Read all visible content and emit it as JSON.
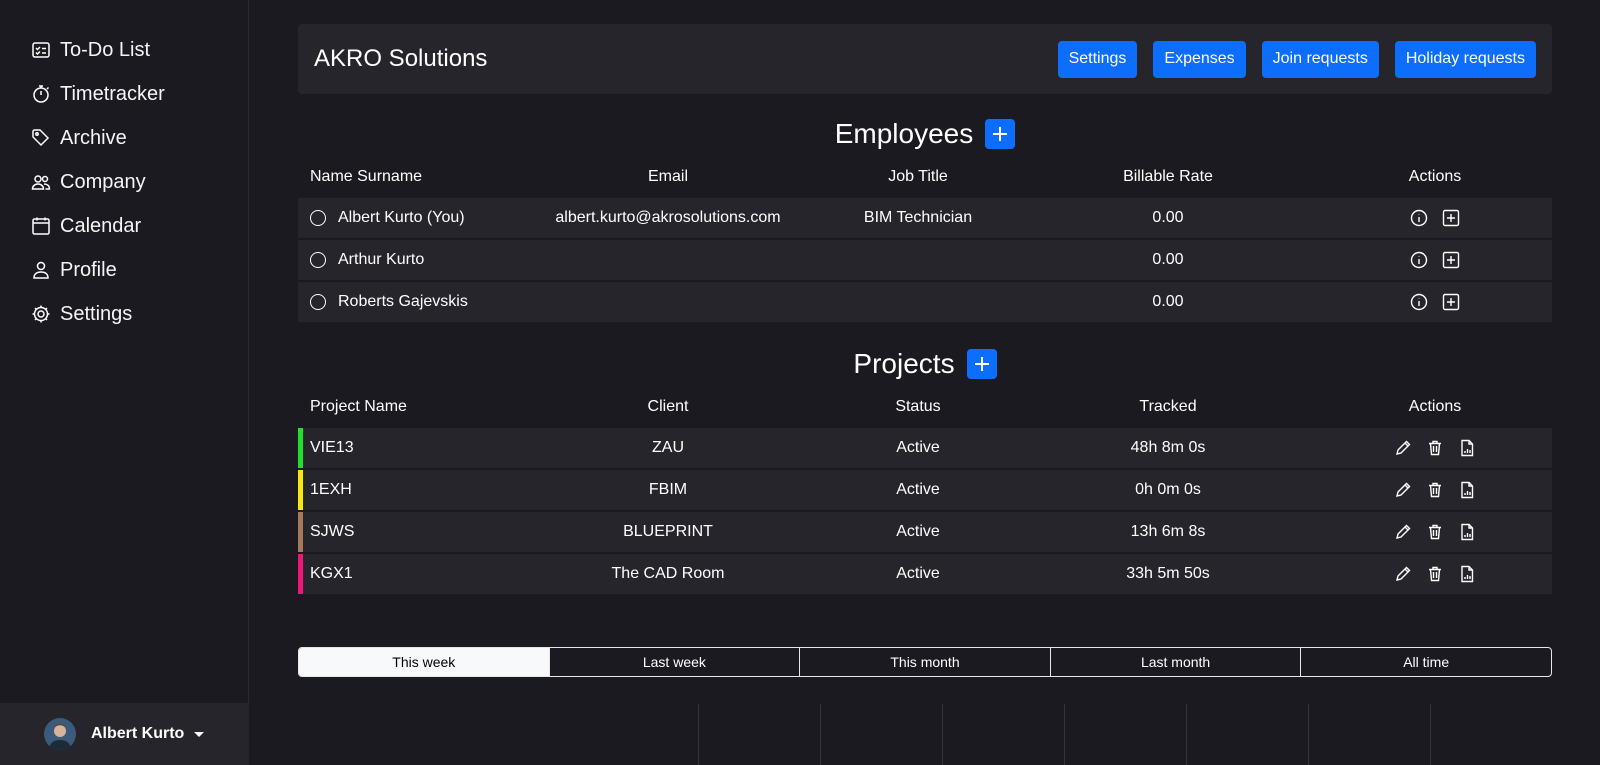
{
  "sidebar": {
    "items": [
      {
        "label": "To-Do List",
        "icon": "list-check-icon"
      },
      {
        "label": "Timetracker",
        "icon": "stopwatch-icon"
      },
      {
        "label": "Archive",
        "icon": "tags-icon"
      },
      {
        "label": "Company",
        "icon": "people-icon"
      },
      {
        "label": "Calendar",
        "icon": "calendar-icon"
      },
      {
        "label": "Profile",
        "icon": "person-icon"
      },
      {
        "label": "Settings",
        "icon": "gear-icon"
      }
    ],
    "user": {
      "name": "Albert Kurto"
    }
  },
  "header": {
    "company": "AKRO Solutions",
    "buttons": {
      "settings": "Settings",
      "expenses": "Expenses",
      "join": "Join requests",
      "holiday": "Holiday requests"
    }
  },
  "employees": {
    "title": "Employees",
    "columns": [
      "Name Surname",
      "Email",
      "Job Title",
      "Billable Rate",
      "Actions"
    ],
    "rows": [
      {
        "name": "Albert Kurto (You)",
        "email": "albert.kurto@akrosolutions.com",
        "job": "BIM Technician",
        "rate": "0.00"
      },
      {
        "name": "Arthur Kurto",
        "email": "",
        "job": "",
        "rate": "0.00"
      },
      {
        "name": "Roberts Gajevskis",
        "email": "",
        "job": "",
        "rate": "0.00"
      }
    ]
  },
  "projects": {
    "title": "Projects",
    "columns": [
      "Project Name",
      "Client",
      "Status",
      "Tracked",
      "Actions"
    ],
    "rows": [
      {
        "name": "VIE13",
        "client": "ZAU",
        "status": "Active",
        "tracked": "48h 8m 0s",
        "color": "#22e02a"
      },
      {
        "name": "1EXH",
        "client": "FBIM",
        "status": "Active",
        "tracked": "0h 0m 0s",
        "color": "#f5e614"
      },
      {
        "name": "SJWS",
        "client": "BLUEPRINT",
        "status": "Active",
        "tracked": "13h 6m 8s",
        "color": "#a47a5a"
      },
      {
        "name": "KGX1",
        "client": "The CAD Room",
        "status": "Active",
        "tracked": "33h 5m 50s",
        "color": "#f01678"
      }
    ]
  },
  "range_tabs": {
    "items": [
      "This week",
      "Last week",
      "This month",
      "Last month",
      "All time"
    ],
    "active": "This week"
  },
  "colors": {
    "accent": "#0d6efd",
    "background": "#1b1a20",
    "panel": "#26252b"
  }
}
